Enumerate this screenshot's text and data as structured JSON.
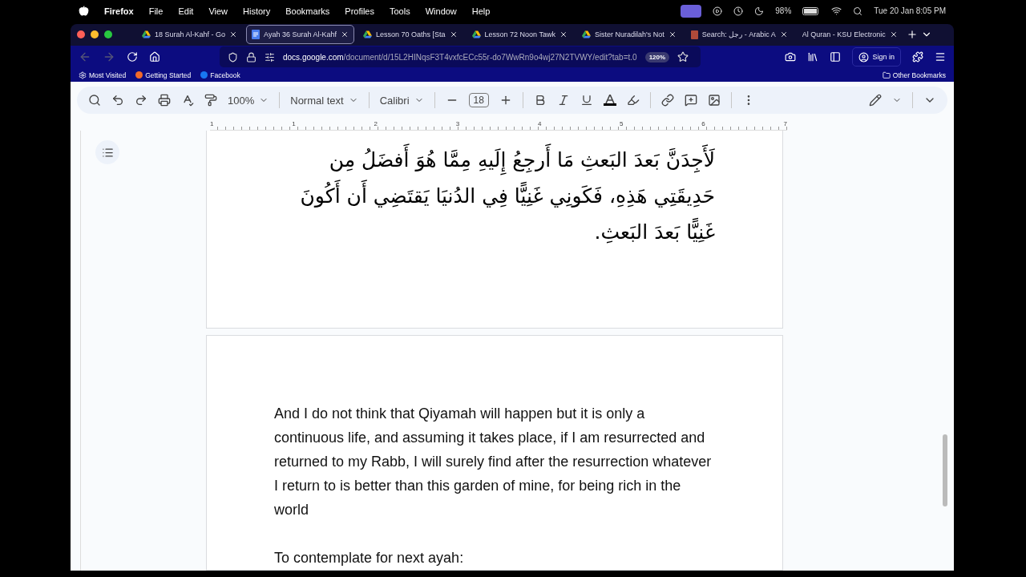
{
  "menu_bar": {
    "app": "Firefox",
    "items": [
      "File",
      "Edit",
      "View",
      "History",
      "Bookmarks",
      "Profiles",
      "Tools",
      "Window",
      "Help"
    ],
    "battery": "98%",
    "clock": "Tue 20 Jan  8:05 PM"
  },
  "tabs": [
    {
      "kind": "drive",
      "label": "18 Surah Al-Kahf - Go",
      "selected": false
    },
    {
      "kind": "docs",
      "label": "Ayah 36 Surah Al-Kahf",
      "selected": true
    },
    {
      "kind": "drive",
      "label": "Lesson 70 Oaths [Sta",
      "selected": false
    },
    {
      "kind": "drive",
      "label": "Lesson 72 Noon Tawk",
      "selected": false
    },
    {
      "kind": "drive",
      "label": "Sister Nuradilah's Not",
      "selected": false
    },
    {
      "kind": "book",
      "label": "Search: رجل - Arabic A",
      "selected": false
    },
    {
      "kind": "none",
      "label": "Al Quran - KSU Electronic",
      "selected": false
    }
  ],
  "address_bar": {
    "domain": "docs.google.com",
    "path": "/document/d/15L2HINqsF3T4vxfcECc55r-do7WwRn9o4wj27N2TVWY/edit?tab=t.0",
    "zoom": "120%"
  },
  "sign_in": "Sign in",
  "bookmarks": [
    "Most Visited",
    "Getting Started",
    "Facebook"
  ],
  "other_bookmarks": "Other Bookmarks",
  "docs_toolbar": {
    "zoom": "100%",
    "style": "Normal text",
    "font": "Calibri",
    "font_size": "18"
  },
  "ruler": [
    "1",
    "1",
    "2",
    "3",
    "4",
    "5",
    "6",
    "7"
  ],
  "arabic_lines": [
    "لَأَجِدَنَّ بَعدَ البَعثِ مَا أَرجِعُ إِلَيهِ مِمَّا هُوَ أَفضَلُ مِن",
    "حَدِيقَتِي هَذِهِ، فَكَونِي غَنِيًّا فِي الدُنيَا يَقتَضِي أَن أَكُونَ",
    "غَنِيًّا بَعدَ البَعثِ."
  ],
  "english_paragraph": "And I do not think that Qiyamah will happen but it is only a continuous life, and assuming it takes place, if I am resurrected and returned to my Rabb, I will surely find after the resurrection whatever I return to is better than this garden of mine, for being rich in the world",
  "next_heading": "To contemplate for next ayah:"
}
